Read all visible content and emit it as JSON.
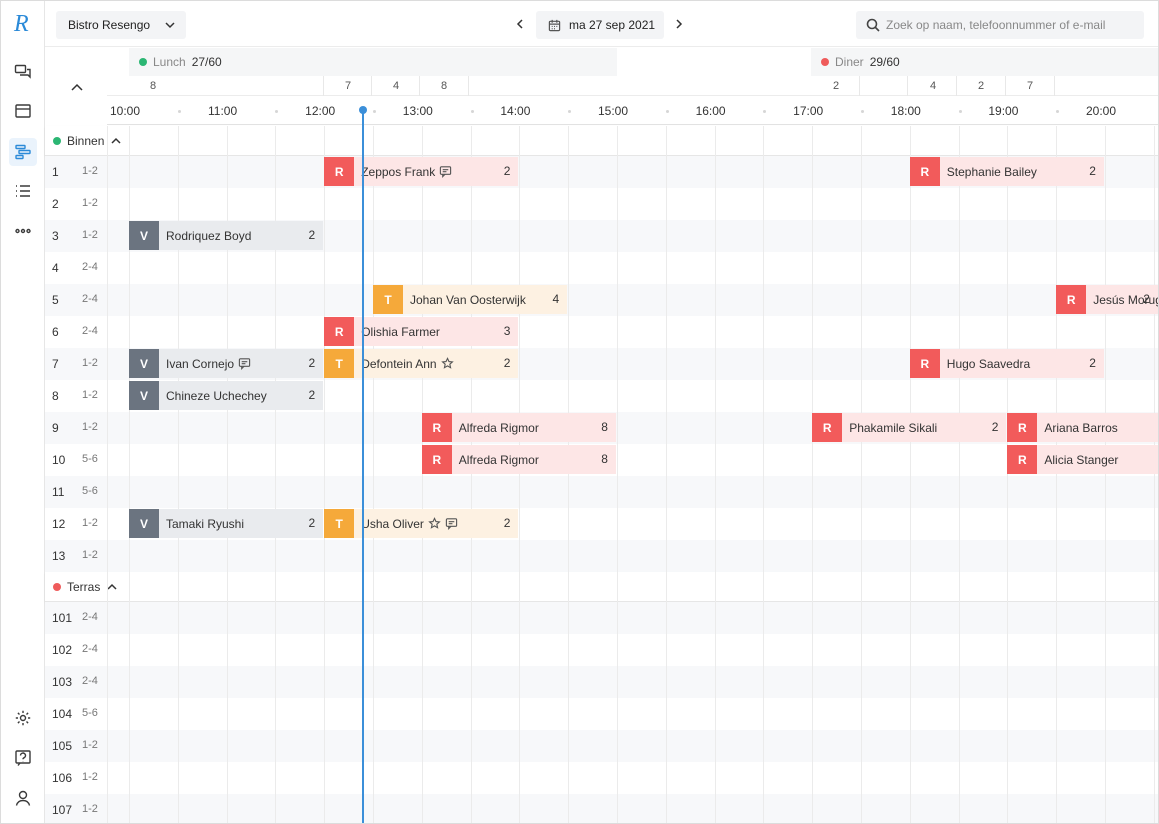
{
  "app": {
    "logo_letter": "R"
  },
  "topbar": {
    "restaurant": "Bistro Resengo",
    "date": "ma 27 sep 2021",
    "search_placeholder": "Zoek op naam, telefoonnummer of e-mail"
  },
  "shifts": [
    {
      "name": "Lunch",
      "count": "27/60",
      "status_color": "#2bb673"
    },
    {
      "name": "Diner",
      "count": "29/60",
      "status_color": "#ef5b5b"
    }
  ],
  "cover_counts": [
    "8",
    "7",
    "4",
    "8",
    "2",
    "4",
    "2",
    "7"
  ],
  "hours": [
    "10:00",
    "11:00",
    "12:00",
    "13:00",
    "14:00",
    "15:00",
    "16:00",
    "17:00",
    "18:00",
    "19:00",
    "20:00"
  ],
  "sections": [
    {
      "name": "Binnen",
      "status_color": "#2bb673",
      "tables": [
        {
          "num": "1",
          "cap": "1-2"
        },
        {
          "num": "2",
          "cap": "1-2"
        },
        {
          "num": "3",
          "cap": "1-2"
        },
        {
          "num": "4",
          "cap": "2-4"
        },
        {
          "num": "5",
          "cap": "2-4"
        },
        {
          "num": "6",
          "cap": "2-4"
        },
        {
          "num": "7",
          "cap": "1-2"
        },
        {
          "num": "8",
          "cap": "1-2"
        },
        {
          "num": "9",
          "cap": "1-2"
        },
        {
          "num": "10",
          "cap": "5-6"
        },
        {
          "num": "11",
          "cap": "5-6"
        },
        {
          "num": "12",
          "cap": "1-2"
        },
        {
          "num": "13",
          "cap": "1-2"
        }
      ]
    },
    {
      "name": "Terras",
      "status_color": "#ef5b5b",
      "tables": [
        {
          "num": "101",
          "cap": "2-4"
        },
        {
          "num": "102",
          "cap": "2-4"
        },
        {
          "num": "103",
          "cap": "2-4"
        },
        {
          "num": "104",
          "cap": "5-6"
        },
        {
          "num": "105",
          "cap": "1-2"
        },
        {
          "num": "106",
          "cap": "1-2"
        },
        {
          "num": "107",
          "cap": "1-2"
        }
      ]
    }
  ],
  "reservations": [
    {
      "row": 0,
      "status": "R",
      "name": "Zeppos Frank",
      "icons": [
        "comment"
      ],
      "persons": "2",
      "start": "12:00",
      "end": "14:00"
    },
    {
      "row": 0,
      "status": "R",
      "name": "Stephanie Bailey",
      "icons": [],
      "persons": "2",
      "start": "18:00",
      "end": "20:00"
    },
    {
      "row": 2,
      "status": "V",
      "name": "Rodriquez Boyd",
      "icons": [],
      "persons": "2",
      "start": "10:00",
      "end": "12:00"
    },
    {
      "row": 4,
      "status": "T",
      "name": "Johan Van Oosterwijk",
      "icons": [],
      "persons": "4",
      "start": "12:30",
      "end": "14:30"
    },
    {
      "row": 4,
      "status": "R",
      "name": "Jesús Moruga",
      "icons": [],
      "persons": "2",
      "start": "19:30",
      "end": "21:30"
    },
    {
      "row": 5,
      "status": "R",
      "name": "Olishia Farmer",
      "icons": [],
      "persons": "3",
      "start": "12:00",
      "end": "14:00"
    },
    {
      "row": 6,
      "status": "V",
      "name": "Ivan Cornejo",
      "icons": [
        "comment"
      ],
      "persons": "2",
      "start": "10:00",
      "end": "12:00"
    },
    {
      "row": 6,
      "status": "T",
      "name": "Defontein Ann",
      "icons": [
        "star"
      ],
      "persons": "2",
      "start": "12:00",
      "end": "14:00"
    },
    {
      "row": 6,
      "status": "R",
      "name": "Hugo Saavedra",
      "icons": [],
      "persons": "2",
      "start": "18:00",
      "end": "20:00"
    },
    {
      "row": 7,
      "status": "V",
      "name": "Chineze Uchechey",
      "icons": [],
      "persons": "2",
      "start": "10:00",
      "end": "12:00"
    },
    {
      "row": 8,
      "status": "R",
      "name": "Alfreda Rigmor",
      "icons": [],
      "persons": "8",
      "start": "13:00",
      "end": "15:00"
    },
    {
      "row": 8,
      "status": "R",
      "name": "Phakamile Sikali",
      "icons": [],
      "persons": "2",
      "start": "17:00",
      "end": "19:00"
    },
    {
      "row": 8,
      "status": "R",
      "name": "Ariana Barros",
      "icons": [],
      "persons": "",
      "start": "19:00",
      "end": "21:00"
    },
    {
      "row": 9,
      "status": "R",
      "name": "Alfreda Rigmor",
      "icons": [],
      "persons": "8",
      "start": "13:00",
      "end": "15:00"
    },
    {
      "row": 9,
      "status": "R",
      "name": "Alicia Stanger",
      "icons": [],
      "persons": "",
      "start": "19:00",
      "end": "21:00"
    },
    {
      "row": 11,
      "status": "V",
      "name": "Tamaki Ryushi",
      "icons": [],
      "persons": "2",
      "start": "10:00",
      "end": "12:00"
    },
    {
      "row": 11,
      "status": "T",
      "name": "Usha Oliver",
      "icons": [
        "star",
        "comment"
      ],
      "persons": "2",
      "start": "12:00",
      "end": "14:00"
    }
  ],
  "current_time": "12:20",
  "colors": {
    "accent": "#3b8fd9",
    "reserved": "#f25b5b",
    "seated": "#6b7480",
    "arrived": "#f5a93a"
  }
}
